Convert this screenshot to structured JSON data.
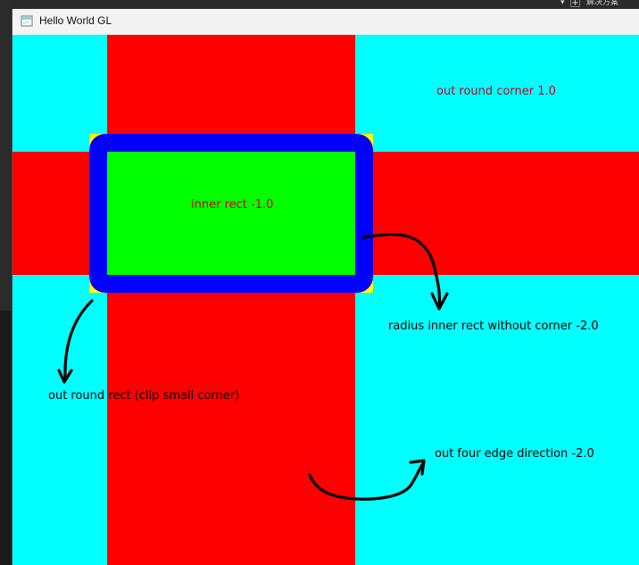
{
  "window": {
    "title": "Hello World GL"
  },
  "background_chrome": {
    "right_icon_arrow": "▾",
    "right_icon_plus": "+",
    "right_text": "解决方案"
  },
  "colors": {
    "cyan": "#00ffff",
    "red": "#ff0000",
    "green": "#00ff00",
    "blue": "#0000ff",
    "yellow": "#ffff00"
  },
  "labels": {
    "out_round_corner": "out round corner 1.0",
    "inner_rect": "inner rect -1.0",
    "radius_inner_rect": "radius inner rect without corner -2.0",
    "out_round_rect": "out round rect (clip small corner)",
    "out_four_edge": "out four edge direction -2.0"
  },
  "icons": {
    "window_icon": "window-icon",
    "arrow": "curved-arrow-icon"
  }
}
